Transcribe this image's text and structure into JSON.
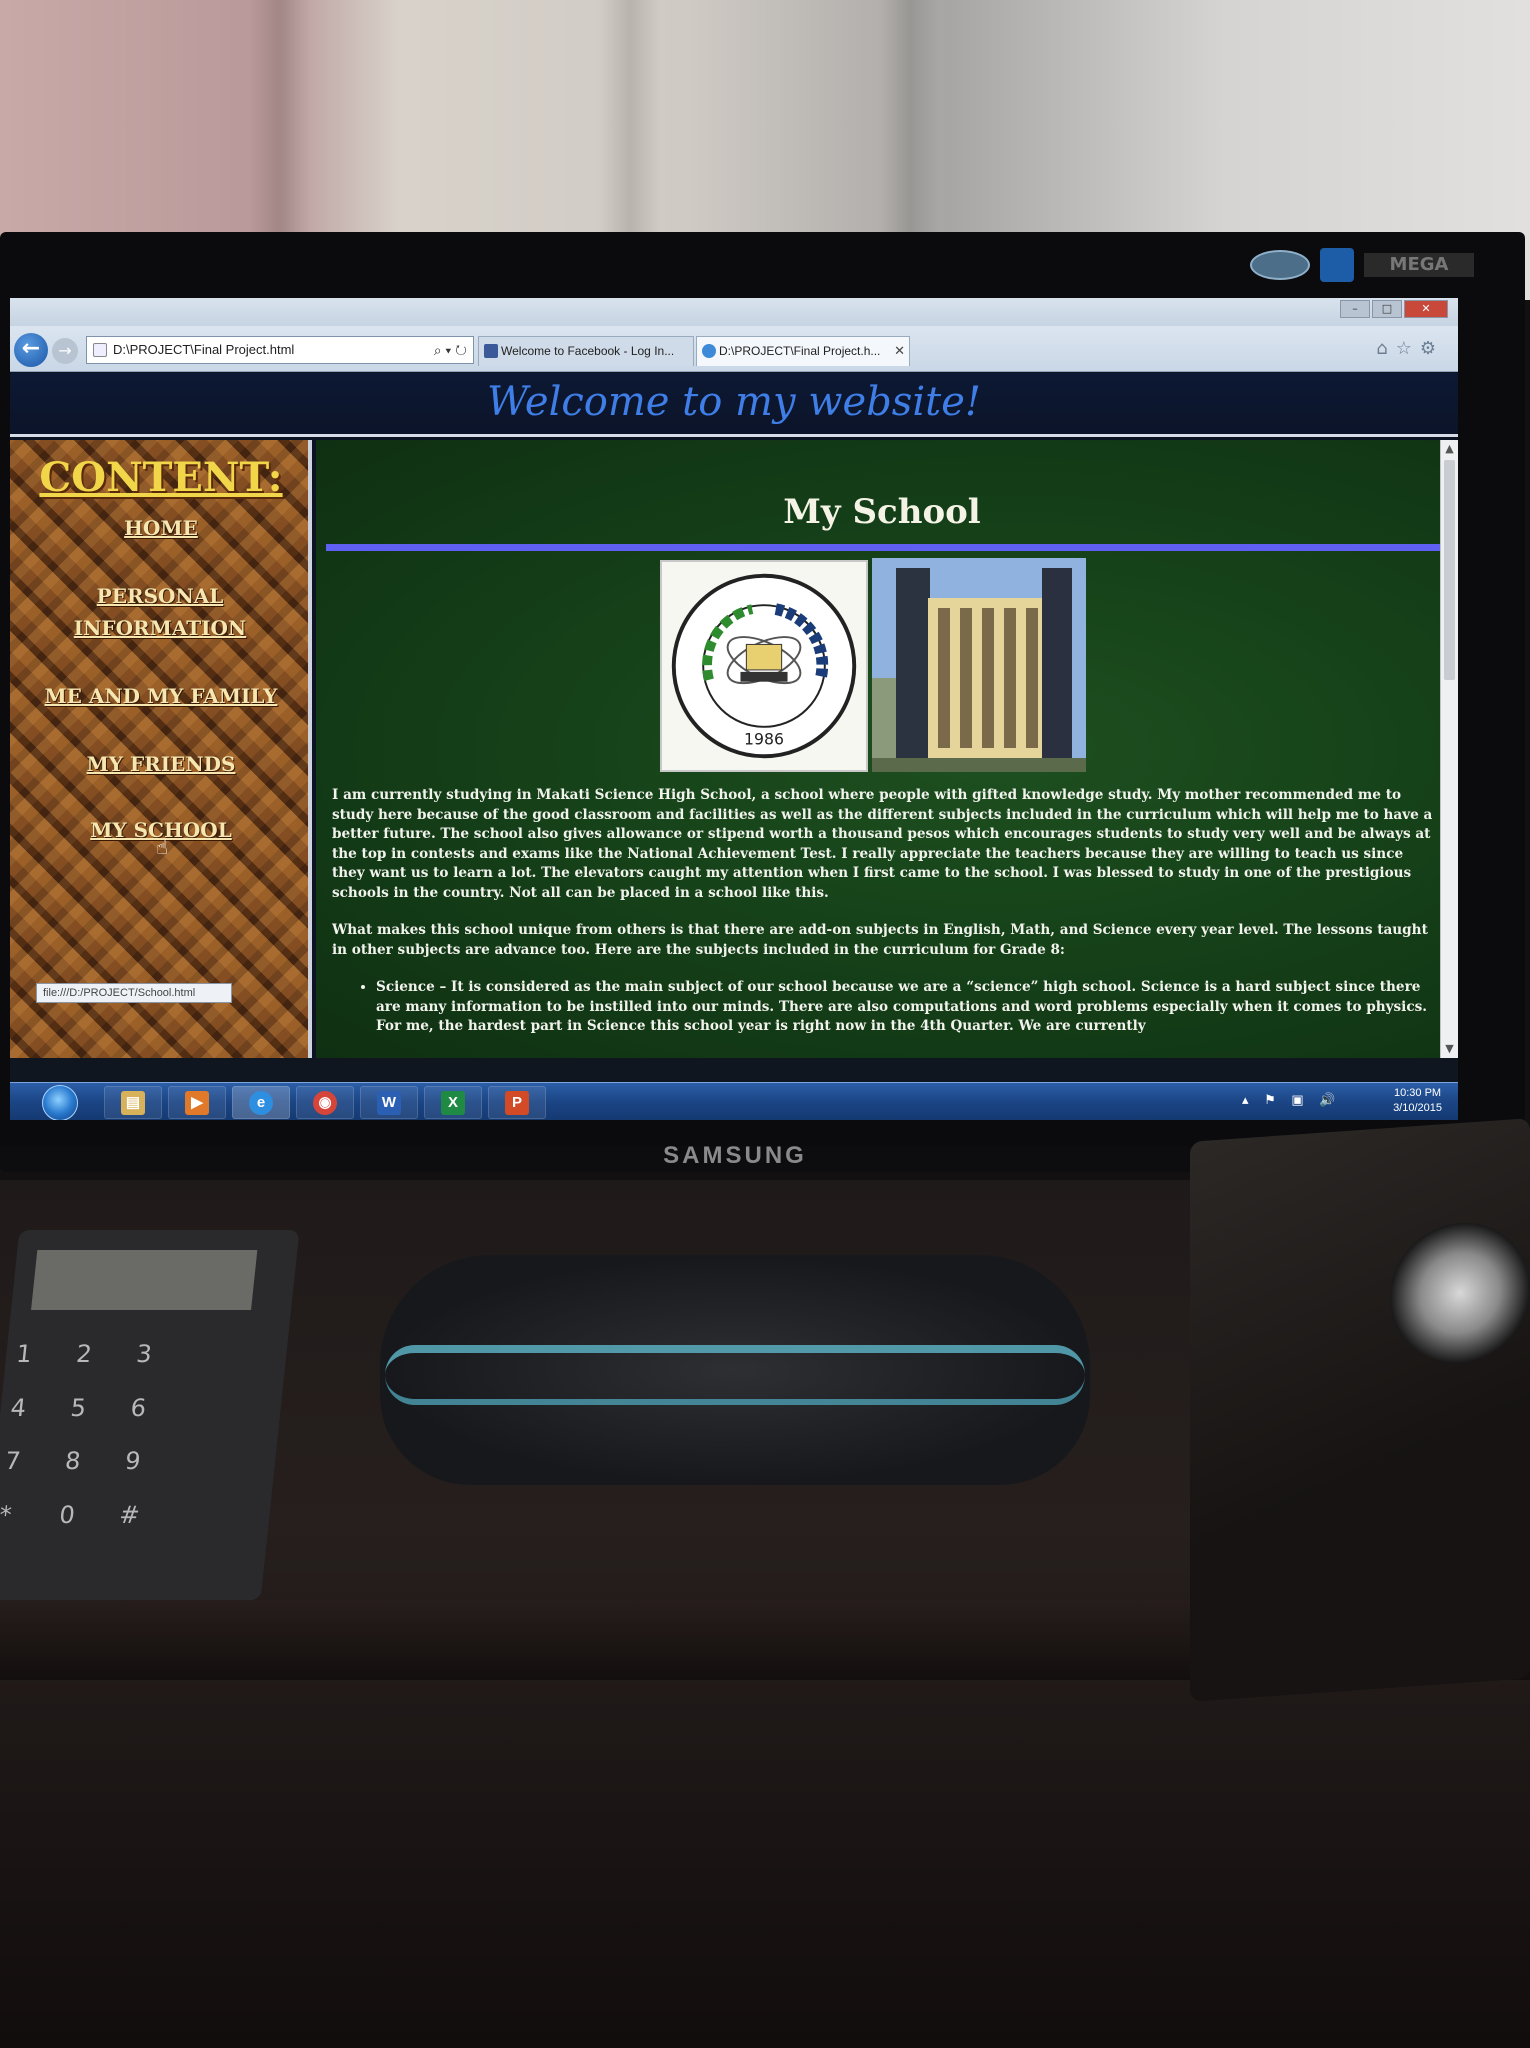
{
  "monitor": {
    "brand": "SAMSUNG"
  },
  "browser": {
    "address": {
      "url": "D:\\PROJECT\\Final Project.html",
      "icons": "⌕ ▾ ↻"
    },
    "tabs": [
      {
        "label": "Welcome to Facebook - Log In...",
        "icon": "facebook-icon"
      },
      {
        "label": "D:\\PROJECT\\Final Project.h...",
        "icon": "ie-page-icon",
        "active": true
      }
    ],
    "window_controls": {
      "minimize": "–",
      "maximize": "□",
      "close": "✕"
    }
  },
  "site": {
    "title": "Welcome to my website!",
    "sidebar": {
      "heading": "CONTENT:",
      "links": [
        "HOME",
        "PERSONAL INFORMATION",
        "ME AND MY FAMILY",
        "MY FRIENDS",
        "MY SCHOOL"
      ]
    },
    "status_bar_text": "file:///D:/PROJECT/School.html",
    "main": {
      "title": "My School",
      "seal_text": {
        "top": "MATAAS NA PAARALANG PANG-AGHAM NG MAKATI",
        "year": "1986"
      },
      "paragraphs": [
        "I am currently studying in Makati Science High School, a school where people with gifted knowledge study. My mother recommended me to study here because of the good classroom and facilities as well as the different subjects included in the curriculum which will help me to have a better future. The school also gives allowance or stipend worth a thousand pesos which encourages students to study very well and be always at the top in contests and exams like the National Achievement Test. I really appreciate the teachers because they are willing to teach us since they want us to learn a lot. The elevators caught my attention when I first came to the school. I was blessed to study in one of the prestigious schools in the country. Not all can be placed in a school like this.",
        "What makes this school unique from others is that there are add-on subjects in English, Math, and Science every year level. The lessons taught in other subjects are advance too. Here are the subjects included in the curriculum for Grade 8:"
      ],
      "list_items": [
        "Science – It is considered as the main subject of our school because we are a “science” high school. Science is a hard subject since there are many information to be instilled into our minds. There are also computations and word problems especially when it comes to physics. For me, the hardest part in Science this school year is right now in the 4th Quarter. We are currently"
      ]
    }
  },
  "taskbar": {
    "apps": [
      {
        "name": "explorer",
        "glyph": "▤",
        "color": "#d8b25a"
      },
      {
        "name": "media-player",
        "glyph": "▶",
        "color": "#e07a2a"
      },
      {
        "name": "internet-explorer",
        "glyph": "e",
        "color": "#2e8ee0"
      },
      {
        "name": "chrome",
        "glyph": "◉",
        "color": "#d6453a"
      },
      {
        "name": "word",
        "glyph": "W",
        "color": "#2b5fb4"
      },
      {
        "name": "excel",
        "glyph": "X",
        "color": "#1f8a44"
      },
      {
        "name": "powerpoint",
        "glyph": "P",
        "color": "#d24a26"
      }
    ],
    "tray_icons": "▴ ⚑ ▣ 🔊",
    "time": "10:30 PM",
    "date": "3/10/2015"
  }
}
